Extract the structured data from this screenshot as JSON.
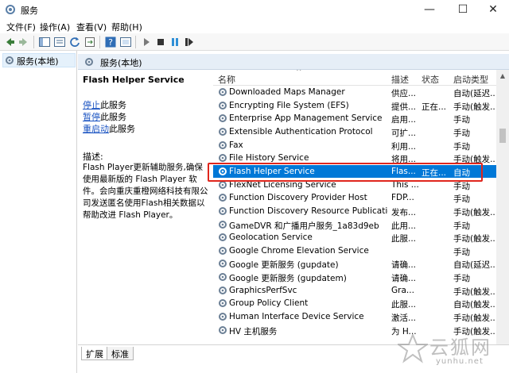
{
  "window": {
    "title": "服务",
    "minimize": "—",
    "maximize": "☐",
    "close": "✕"
  },
  "menu": [
    "文件(F)",
    "操作(A)",
    "查看(V)",
    "帮助(H)"
  ],
  "tree": {
    "item": "服务(本地)"
  },
  "pane": {
    "header": "服务(本地)"
  },
  "details": {
    "service_title": "Flash Helper Service",
    "actions": [
      {
        "link": "停止",
        "rest": "此服务"
      },
      {
        "link": "暂停",
        "rest": "此服务"
      },
      {
        "link": "重启动",
        "rest": "此服务"
      }
    ],
    "desc_label": "描述:",
    "desc_text": "Flash Player更新辅助服务,确保使用最新版的 Flash Player 软件。会向重庆重橙网络科技有限公司发送匿名使用Flash相关数据以帮助改进 Flash Player。"
  },
  "list": {
    "columns": {
      "name": "名称",
      "desc": "描述",
      "status": "状态",
      "start": "启动类型"
    },
    "rows": [
      {
        "name": "Downloaded Maps Manager",
        "desc": "供应...",
        "status": "",
        "start": "自动(延迟..."
      },
      {
        "name": "Encrypting File System (EFS)",
        "desc": "提供...",
        "status": "正在...",
        "start": "手动(触发..."
      },
      {
        "name": "Enterprise App Management Service",
        "desc": "启用...",
        "status": "",
        "start": "手动"
      },
      {
        "name": "Extensible Authentication Protocol",
        "desc": "可扩...",
        "status": "",
        "start": "手动"
      },
      {
        "name": "Fax",
        "desc": "利用...",
        "status": "",
        "start": "手动"
      },
      {
        "name": "File History Service",
        "desc": "将用...",
        "status": "",
        "start": "手动(触发..."
      },
      {
        "name": "Flash Helper Service",
        "desc": "Flas...",
        "status": "正在...",
        "start": "自动",
        "selected": true
      },
      {
        "name": "FlexNet Licensing Service",
        "desc": "This ...",
        "status": "",
        "start": "手动"
      },
      {
        "name": "Function Discovery Provider Host",
        "desc": "FDP...",
        "status": "",
        "start": "手动"
      },
      {
        "name": "Function Discovery Resource Publication",
        "desc": "发布...",
        "status": "",
        "start": "手动(触发..."
      },
      {
        "name": "GameDVR 和广播用户服务_1a83d9eb",
        "desc": "此用...",
        "status": "",
        "start": "手动"
      },
      {
        "name": "Geolocation Service",
        "desc": "此服...",
        "status": "",
        "start": "手动(触发..."
      },
      {
        "name": "Google Chrome Elevation Service",
        "desc": "",
        "status": "",
        "start": "手动"
      },
      {
        "name": "Google 更新服务 (gupdate)",
        "desc": "请确...",
        "status": "",
        "start": "自动(延迟..."
      },
      {
        "name": "Google 更新服务 (gupdatem)",
        "desc": "请确...",
        "status": "",
        "start": "手动"
      },
      {
        "name": "GraphicsPerfSvc",
        "desc": "Gra...",
        "status": "",
        "start": "手动(触发..."
      },
      {
        "name": "Group Policy Client",
        "desc": "此服...",
        "status": "",
        "start": "自动(触发..."
      },
      {
        "name": "Human Interface Device Service",
        "desc": "激活...",
        "status": "",
        "start": "手动(触发..."
      },
      {
        "name": "HV 主机服务",
        "desc": "为 H...",
        "status": "",
        "start": "手动(触发..."
      }
    ]
  },
  "tabs": [
    "扩展",
    "标准"
  ],
  "watermark": {
    "big": "云狐网",
    "small": "yunhu.net"
  },
  "colors": {
    "selected": "#0078d7",
    "highlight_box": "#e0261d",
    "link": "#1a53c2"
  }
}
